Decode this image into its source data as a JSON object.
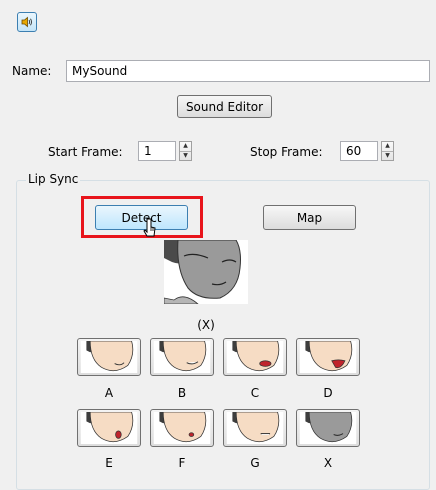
{
  "top_icon": "speaker-icon",
  "name_label": "Name:",
  "name_value": "MySound",
  "sound_editor_label": "Sound Editor",
  "start_frame_label": "Start Frame:",
  "start_frame_value": "1",
  "stop_frame_label": "Stop Frame:",
  "stop_frame_value": "60",
  "lip_sync_title": "Lip Sync",
  "detect_label": "Detect",
  "map_label": "Map",
  "current_mouth_label": "(X)",
  "mouths": [
    {
      "letter": "A"
    },
    {
      "letter": "B"
    },
    {
      "letter": "C"
    },
    {
      "letter": "D"
    },
    {
      "letter": "E"
    },
    {
      "letter": "F"
    },
    {
      "letter": "G"
    },
    {
      "letter": "X"
    }
  ],
  "highlight_color": "#e8141b",
  "mouth_color": "#c0242c"
}
